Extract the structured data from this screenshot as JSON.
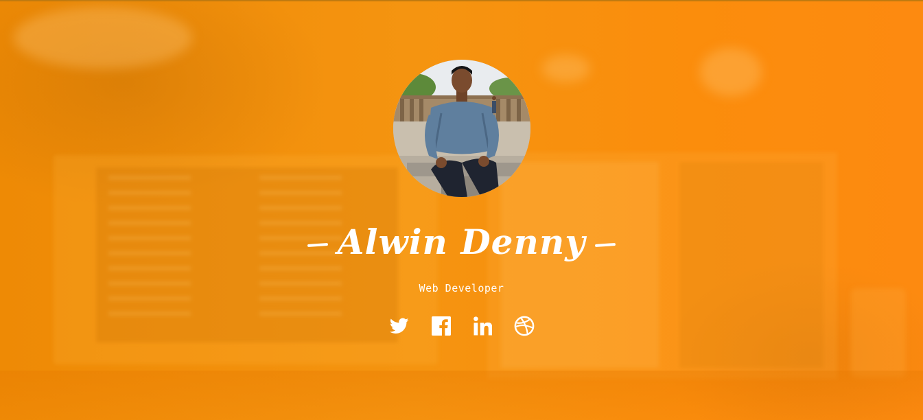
{
  "profile": {
    "name": "Alwin Denny",
    "role": "Web Developer",
    "avatar_alt": "Profile photo"
  },
  "socials": [
    {
      "icon": "twitter-icon",
      "label": "Twitter"
    },
    {
      "icon": "facebook-icon",
      "label": "Facebook"
    },
    {
      "icon": "linkedin-icon",
      "label": "LinkedIn"
    },
    {
      "icon": "dribbble-icon",
      "label": "Dribbble"
    }
  ],
  "colors": {
    "background": "#f7920f",
    "text": "#ffffff"
  }
}
